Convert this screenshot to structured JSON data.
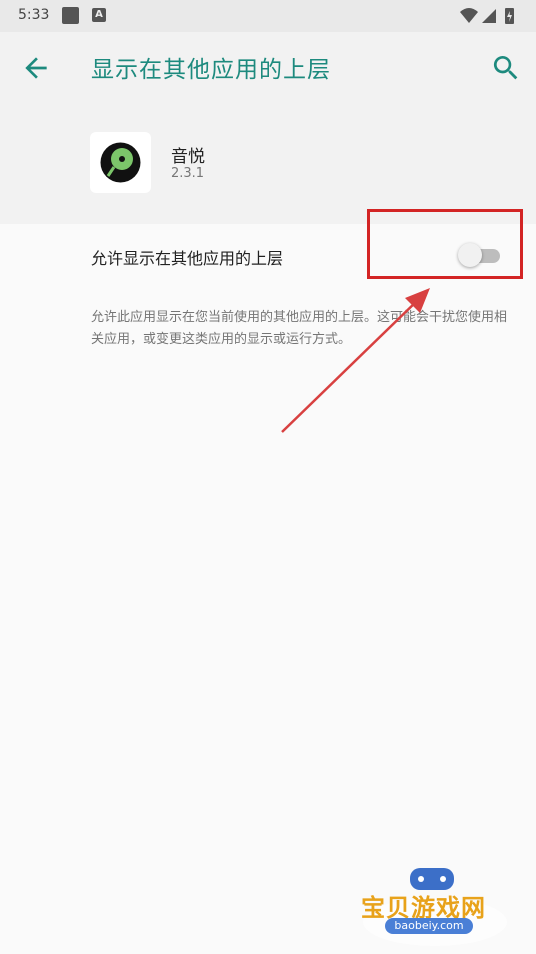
{
  "status_bar": {
    "time": "5:33",
    "notification_icons": [
      "square-icon",
      "text-a-icon"
    ],
    "right_icons": [
      "wifi-icon",
      "signal-icon",
      "battery-icon"
    ],
    "a_icon_label": "A"
  },
  "toolbar": {
    "title": "显示在其他应用的上层",
    "back_icon": "arrow-back-icon",
    "search_icon": "search-icon"
  },
  "app": {
    "name": "音悦",
    "version": "2.3.1",
    "icon": "vinyl-record-icon"
  },
  "setting": {
    "label": "允许显示在其他应用的上层",
    "toggle_state": "off",
    "description": "允许此应用显示在您当前使用的其他应用的上层。这可能会干扰您使用相关应用，或变更这类应用的显示或运行方式。"
  },
  "annotation": {
    "highlight_color": "#d32424"
  },
  "watermark": {
    "name": "宝贝游戏网",
    "domain": "baobeiy.com"
  },
  "colors": {
    "accent": "#1d8a7e",
    "header_bg": "#f2f2f2",
    "page_bg": "#fafafa",
    "status_bar_bg": "#e9e9e9"
  }
}
